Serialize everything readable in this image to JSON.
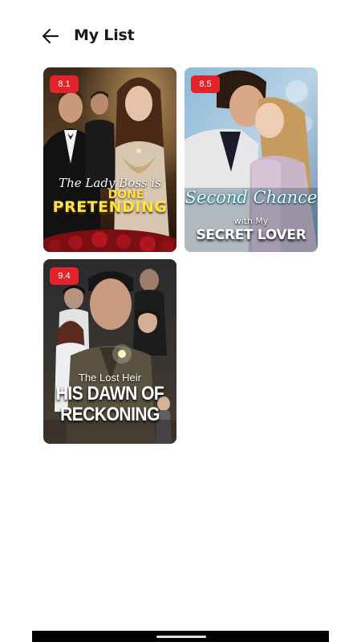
{
  "header": {
    "title": "My List",
    "back_icon": "arrow-left-icon"
  },
  "list": [
    {
      "rating": "8.1",
      "title_script": "The Lady Boss is",
      "title_line1": "DONE",
      "title_line2": "PRETENDING"
    },
    {
      "rating": "8.5",
      "title_script": "Second Chance",
      "title_small": "with My",
      "title_main": "SECRET LOVER"
    },
    {
      "rating": "9.4",
      "title_small": "The Lost Heir",
      "title_line1": "HIS DAWN OF",
      "title_line2": "RECKONING"
    }
  ],
  "colors": {
    "badge": "#e0242a",
    "background": "#ffffff",
    "title": "#1a1a1a"
  }
}
